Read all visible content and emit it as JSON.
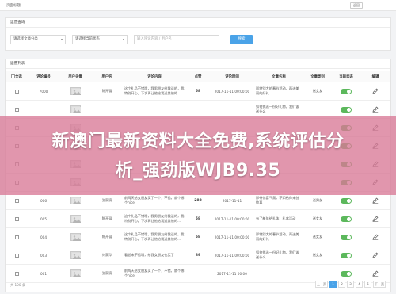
{
  "topbar": {
    "breadcrumb": "页面标题",
    "back_label": "返回"
  },
  "search": {
    "title": "运营查询",
    "category_select": "请选择文章分类",
    "status_select": "请选择当前状态",
    "keyword_placeholder": "输入评论内容 / 用户名",
    "search_button": "搜索"
  },
  "list": {
    "title": "运营列表",
    "columns": [
      "全选",
      "评论编号",
      "用户头像",
      "用户名",
      "评论内容",
      "点赞",
      "评论时间",
      "文章名称",
      "文章类别",
      "当前状态",
      "编辑"
    ],
    "rows": [
      {
        "id": "7000",
        "user": "陈开展",
        "content": "这个礼品不错哦，我男朋友给我送的，我特别开心。下次再让他给我送其他的...",
        "likes": "58",
        "time": "2017-11-11 00:00:00",
        "article": "那特别大的春节活动，再送美丽的好礼",
        "category": "送女友"
      },
      {
        "id": "",
        "user": "",
        "content": "",
        "likes": "",
        "time": "",
        "article": "如何挑选一份好礼物，我们该送什么",
        "category": ""
      },
      {
        "id": "",
        "user": "",
        "content": "",
        "likes": "",
        "time": "",
        "article": "",
        "category": ""
      },
      {
        "id": "",
        "user": "",
        "content": "",
        "likes": "",
        "time": "",
        "article": "",
        "category": ""
      },
      {
        "id": "",
        "user": "",
        "content": "",
        "likes": "",
        "time": "",
        "article": "",
        "category": ""
      },
      {
        "id": "",
        "user": "",
        "content": "",
        "likes": "",
        "time": "",
        "article": "",
        "category": ""
      },
      {
        "id": "006",
        "user": "张家演",
        "content": "前两天给女朋友买了一个，不错，就个哪个hice",
        "likes": "282",
        "time": "2017-11-11",
        "article": "那带惊喜气氛，不如给你来创惊喜",
        "category": "送男友"
      },
      {
        "id": "005",
        "user": "陈开展",
        "content": "这个礼品不错哦，我男朋友给我送的，我特别开心。下次再让他给我送其他的...",
        "likes": "58",
        "time": "2017-11-11 00:00:00",
        "article": "有了新年给礼体，礼盒活动",
        "category": "送女友"
      },
      {
        "id": "004",
        "user": "陈开展",
        "content": "这个礼品不错哦，我男朋友给我送的，我特别开心。下次再让他给我送其他的...",
        "likes": "58",
        "time": "2017-11-11 00:00:00",
        "article": "那特别大的春节活动，再送美丽的好礼",
        "category": "送女友"
      },
      {
        "id": "003",
        "user": "刘家华",
        "content": "看起来不错哦，给我女朋友也买了",
        "likes": "89",
        "time": "2017-11-11 00:00:00",
        "article": "如何挑选一份好礼物，我们该送什么",
        "category": "送女友"
      },
      {
        "id": "001",
        "user": "张家演",
        "content": "前两天给女朋友买了一个，不错，就个哪个hice",
        "likes": "",
        "time": "2017-11-11 00:00",
        "article": "",
        "category": ""
      }
    ],
    "pager": {
      "info": "共 100 条",
      "pages": [
        "上一页",
        "1",
        "2",
        "3",
        "4",
        "5",
        "下一页"
      ]
    }
  },
  "watermark": {
    "line1": "新澳门最新资料大全免费,系统评估分",
    "line2": "析_强劲版WJB9.35"
  },
  "colors": {
    "accent": "#4aa3e8",
    "toggle_on": "#5cb85c",
    "watermark": "#d87896"
  },
  "icons": {
    "avatar": "image-icon",
    "edit": "edit-icon"
  }
}
